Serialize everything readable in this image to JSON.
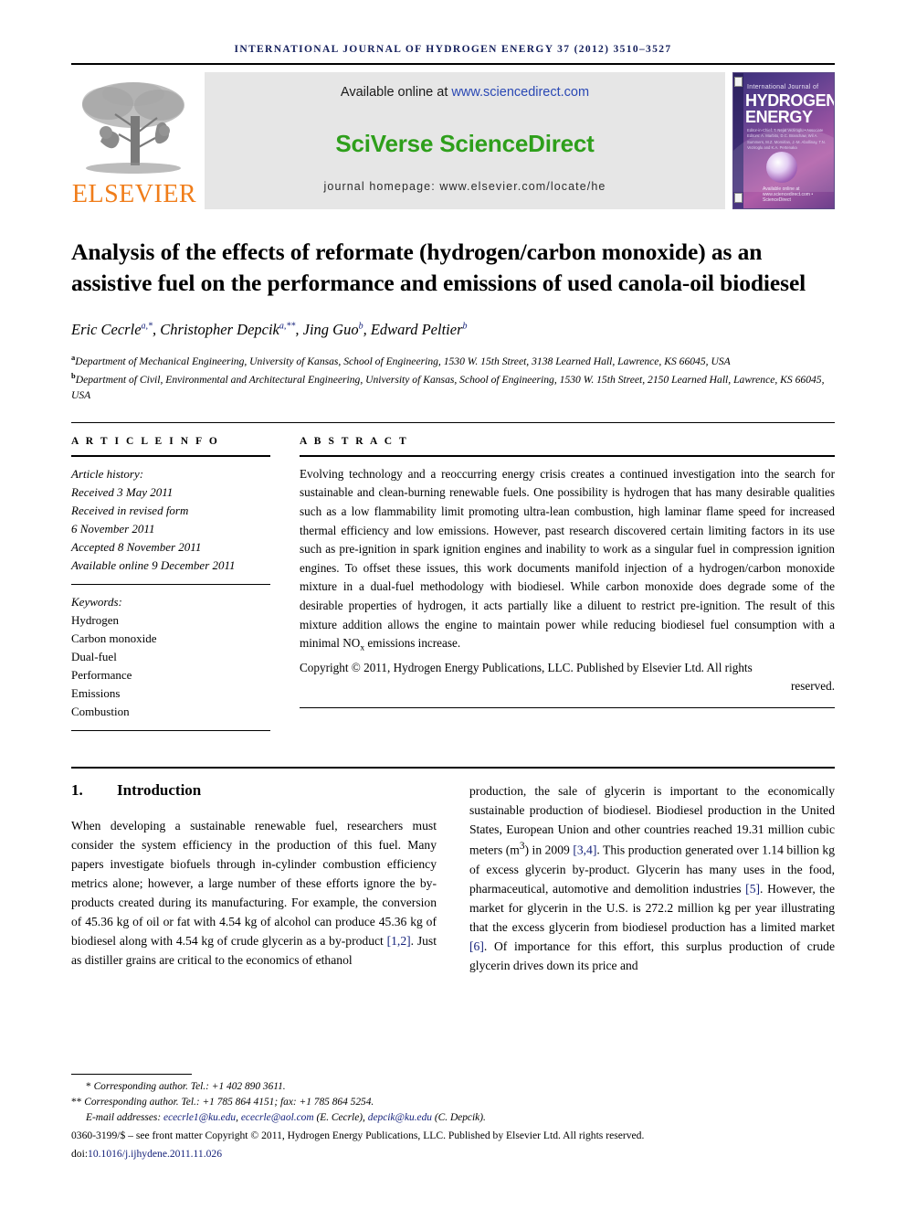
{
  "runhead": "international journal of hydrogen energy 37 (2012) 3510–3527",
  "masthead": {
    "publisher_logo_text": "ELSEVIER",
    "available_prefix": "Available online at ",
    "available_url": "www.sciencedirect.com",
    "brand": "SciVerse ScienceDirect",
    "homepage": "journal homepage: www.elsevier.com/locate/he",
    "cover": {
      "line_small": "International Journal of",
      "line1": "HYDROGEN",
      "line2": "ENERGY",
      "editors": "Editor-in-Chief: T. Nejat Veziroglu   •   Associate Editors: A. Marbito, D.C. Branchaw, Wil A. Summers, M.Z. Momirlan, J.-M. Abollinay, T.N. Veziroglu and K.A. Pertenaka",
      "footer": "Available online at www.sciencedirect.com  •  ScienceDirect"
    }
  },
  "article": {
    "title": "Analysis of the effects of reformate (hydrogen/carbon monoxide) as an assistive fuel on the performance and emissions of used canola-oil biodiesel",
    "authors": [
      {
        "name": "Eric Cecrle",
        "marks": "a,*"
      },
      {
        "name": "Christopher Depcik",
        "marks": "a,**"
      },
      {
        "name": "Jing Guo",
        "marks": "b"
      },
      {
        "name": "Edward Peltier",
        "marks": "b"
      }
    ],
    "affiliations": [
      {
        "mark": "a",
        "text": "Department of Mechanical Engineering, University of Kansas, School of Engineering, 1530 W. 15th Street, 3138 Learned Hall, Lawrence, KS 66045, USA"
      },
      {
        "mark": "b",
        "text": "Department of Civil, Environmental and Architectural Engineering, University of Kansas, School of Engineering, 1530 W. 15th Street, 2150 Learned Hall, Lawrence, KS 66045, USA"
      }
    ]
  },
  "article_info": {
    "heading": "A R T I C L E   I N F O",
    "history_label": "Article history:",
    "history": [
      "Received 3 May 2011",
      "Received in revised form",
      "6 November 2011",
      "Accepted 8 November 2011",
      "Available online 9 December 2011"
    ],
    "keywords_label": "Keywords:",
    "keywords": [
      "Hydrogen",
      "Carbon monoxide",
      "Dual-fuel",
      "Performance",
      "Emissions",
      "Combustion"
    ]
  },
  "abstract": {
    "heading": "A B S T R A C T",
    "body_part1": "Evolving technology and a reoccurring energy crisis creates a continued investigation into the search for sustainable and clean-burning renewable fuels. One possibility is hydrogen that has many desirable qualities such as a low flammability limit promoting ultra-lean combustion, high laminar flame speed for increased thermal efficiency and low emissions. However, past research discovered certain limiting factors in its use such as pre-ignition in spark ignition engines and inability to work as a singular fuel in compression ignition engines. To offset these issues, this work documents manifold injection of a hydrogen/carbon monoxide mixture in a dual-fuel methodology with biodiesel. While carbon monoxide does degrade some of the desirable properties of hydrogen, it acts partially like a diluent to restrict pre-ignition. The result of this mixture addition allows the engine to maintain power while reducing biodiesel fuel consumption with a minimal NO",
    "body_sub": "x",
    "body_part2": " emissions increase.",
    "copyright_main": "Copyright © 2011, Hydrogen Energy Publications, LLC. Published by Elsevier Ltd. All rights",
    "copyright_tail": "reserved."
  },
  "section": {
    "number": "1.",
    "title": "Introduction",
    "left_column": "When developing a sustainable renewable fuel, researchers must consider the system efficiency in the production of this fuel. Many papers investigate biofuels through in-cylinder combustion efficiency metrics alone; however, a large number of these efforts ignore the by-products created during its manufacturing. For example, the conversion of 45.36 kg of oil or fat with 4.54 kg of alcohol can produce 45.36 kg of biodiesel along with 4.54 kg of crude glycerin as a by-product ",
    "left_ref": "[1,2]",
    "left_column_tail": ". Just as distiller grains are critical to the economics of ethanol",
    "right_seg1": "production, the sale of glycerin is important to the economically sustainable production of biodiesel. Biodiesel production in the United States, European Union and other countries reached 19.31 million cubic meters (m",
    "right_sup1": "3",
    "right_seg2": ") in 2009 ",
    "right_ref1": "[3,4]",
    "right_seg3": ". This production generated over 1.14 billion kg of excess glycerin by-product. Glycerin has many uses in the food, pharmaceutical, automotive and demolition industries ",
    "right_ref2": "[5]",
    "right_seg4": ". However, the market for glycerin in the U.S. is 272.2 million kg per year illustrating that the excess glycerin from biodiesel production has a limited market ",
    "right_ref3": "[6]",
    "right_seg5": ". Of importance for this effort, this surplus production of crude glycerin drives down its price and"
  },
  "footnotes": {
    "corr1_mark": "*",
    "corr1": "Corresponding author. Tel.: +1 402 890 3611.",
    "corr2_mark": "**",
    "corr2": "Corresponding author. Tel.: +1 785 864 4151; fax: +1 785 864 5254.",
    "email_label": "E-mail addresses:",
    "email1": "ececrle1@ku.edu",
    "email2": "ececrle@aol.com",
    "email1_owner": "(E. Cecrle),",
    "email3": "depcik@ku.edu",
    "email3_owner": "(C. Depcik).",
    "imprint": "0360-3199/$ – see front matter Copyright © 2011, Hydrogen Energy Publications, LLC. Published by Elsevier Ltd. All rights reserved.",
    "doi_label": "doi:",
    "doi_value": "10.1016/j.ijhydene.2011.11.026"
  },
  "colors": {
    "runhead": "#141f5c",
    "elsevier_orange": "#f07d1a",
    "sciencedirect_green": "#2e9f1b",
    "link_blue": "#2a48b4",
    "ref_blue": "#14217a",
    "banner_gray": "#e6e6e6"
  }
}
